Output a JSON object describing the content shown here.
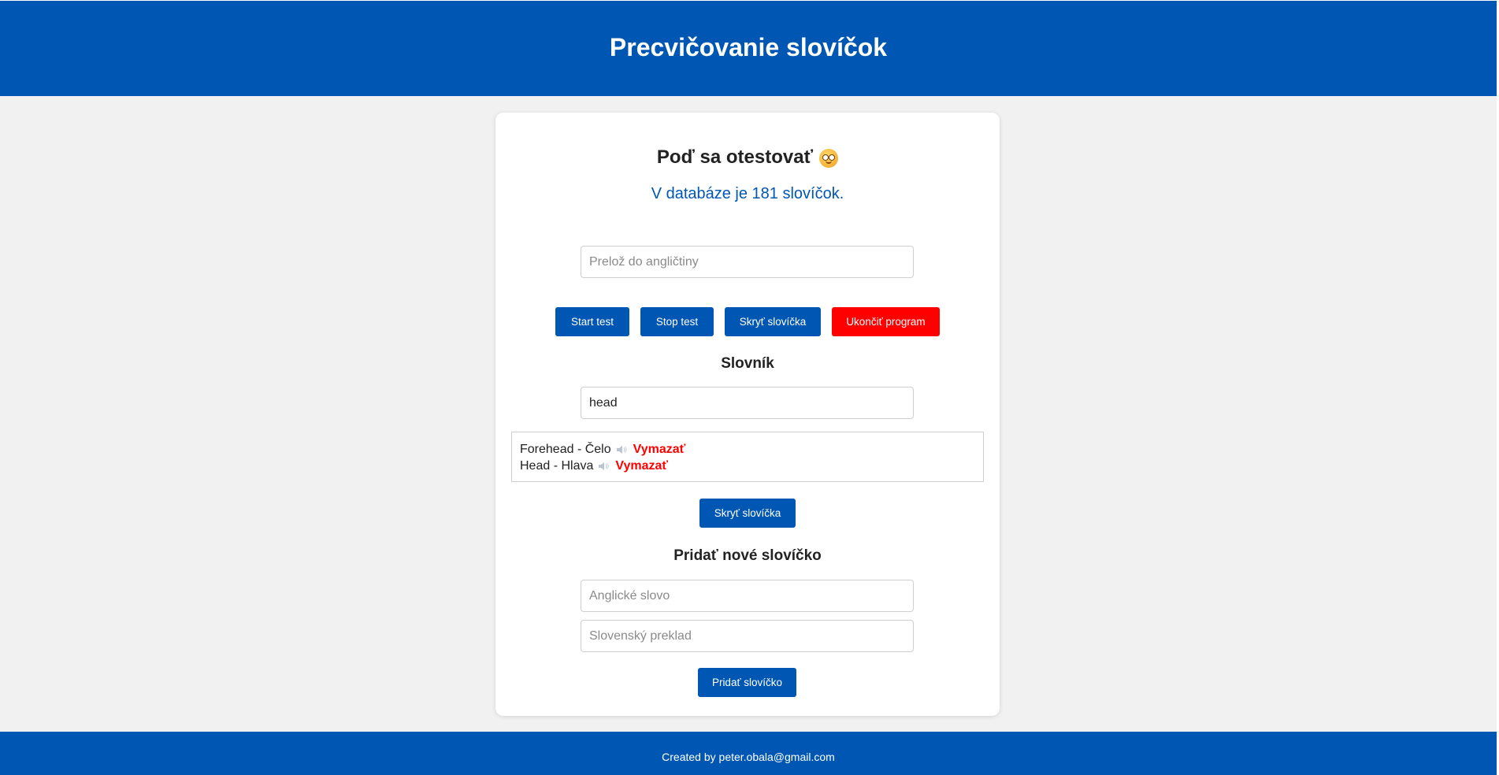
{
  "header": {
    "title": "Precvičovanie slovíčok"
  },
  "test": {
    "heading": "Poď sa otestovať",
    "heading_icon": "smiling-face-emoji",
    "db_count": "V databáze je 181 slovíčok.",
    "translate_placeholder": "Prelož do angličtiny",
    "buttons": {
      "start": "Start test",
      "stop": "Stop test",
      "hide": "Skryť slovíčka",
      "quit": "Ukončiť program"
    }
  },
  "dictionary": {
    "title": "Slovník",
    "search_value": "head",
    "results": [
      {
        "text": "Forehead - Čelo",
        "icon": "speaker-icon",
        "delete_label": "Vymazať"
      },
      {
        "text": "Head - Hlava",
        "icon": "speaker-icon",
        "delete_label": "Vymazať"
      }
    ],
    "hide_button": "Skryť slovíčka"
  },
  "add_word": {
    "title": "Pridať nové slovíčko",
    "english_placeholder": "Anglické slovo",
    "slovak_placeholder": "Slovenský preklad",
    "add_button": "Pridať slovíčko"
  },
  "footer": {
    "text": "Created by peter.obala@gmail.com"
  },
  "colors": {
    "primary": "#0056b3",
    "danger": "#ff0000",
    "background": "#f1f1f1"
  }
}
